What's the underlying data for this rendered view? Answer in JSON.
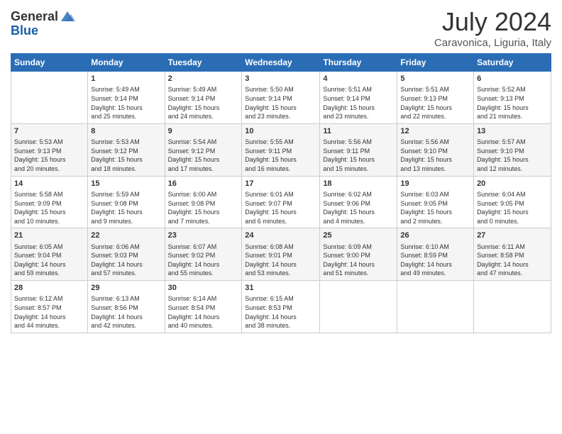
{
  "header": {
    "logo_general": "General",
    "logo_blue": "Blue",
    "month_title": "July 2024",
    "location": "Caravonica, Liguria, Italy"
  },
  "days_of_week": [
    "Sunday",
    "Monday",
    "Tuesday",
    "Wednesday",
    "Thursday",
    "Friday",
    "Saturday"
  ],
  "weeks": [
    [
      {
        "day": "",
        "content": ""
      },
      {
        "day": "1",
        "content": "Sunrise: 5:49 AM\nSunset: 9:14 PM\nDaylight: 15 hours\nand 25 minutes."
      },
      {
        "day": "2",
        "content": "Sunrise: 5:49 AM\nSunset: 9:14 PM\nDaylight: 15 hours\nand 24 minutes."
      },
      {
        "day": "3",
        "content": "Sunrise: 5:50 AM\nSunset: 9:14 PM\nDaylight: 15 hours\nand 23 minutes."
      },
      {
        "day": "4",
        "content": "Sunrise: 5:51 AM\nSunset: 9:14 PM\nDaylight: 15 hours\nand 23 minutes."
      },
      {
        "day": "5",
        "content": "Sunrise: 5:51 AM\nSunset: 9:13 PM\nDaylight: 15 hours\nand 22 minutes."
      },
      {
        "day": "6",
        "content": "Sunrise: 5:52 AM\nSunset: 9:13 PM\nDaylight: 15 hours\nand 21 minutes."
      }
    ],
    [
      {
        "day": "7",
        "content": "Sunrise: 5:53 AM\nSunset: 9:13 PM\nDaylight: 15 hours\nand 20 minutes."
      },
      {
        "day": "8",
        "content": "Sunrise: 5:53 AM\nSunset: 9:12 PM\nDaylight: 15 hours\nand 18 minutes."
      },
      {
        "day": "9",
        "content": "Sunrise: 5:54 AM\nSunset: 9:12 PM\nDaylight: 15 hours\nand 17 minutes."
      },
      {
        "day": "10",
        "content": "Sunrise: 5:55 AM\nSunset: 9:11 PM\nDaylight: 15 hours\nand 16 minutes."
      },
      {
        "day": "11",
        "content": "Sunrise: 5:56 AM\nSunset: 9:11 PM\nDaylight: 15 hours\nand 15 minutes."
      },
      {
        "day": "12",
        "content": "Sunrise: 5:56 AM\nSunset: 9:10 PM\nDaylight: 15 hours\nand 13 minutes."
      },
      {
        "day": "13",
        "content": "Sunrise: 5:57 AM\nSunset: 9:10 PM\nDaylight: 15 hours\nand 12 minutes."
      }
    ],
    [
      {
        "day": "14",
        "content": "Sunrise: 5:58 AM\nSunset: 9:09 PM\nDaylight: 15 hours\nand 10 minutes."
      },
      {
        "day": "15",
        "content": "Sunrise: 5:59 AM\nSunset: 9:08 PM\nDaylight: 15 hours\nand 9 minutes."
      },
      {
        "day": "16",
        "content": "Sunrise: 6:00 AM\nSunset: 9:08 PM\nDaylight: 15 hours\nand 7 minutes."
      },
      {
        "day": "17",
        "content": "Sunrise: 6:01 AM\nSunset: 9:07 PM\nDaylight: 15 hours\nand 6 minutes."
      },
      {
        "day": "18",
        "content": "Sunrise: 6:02 AM\nSunset: 9:06 PM\nDaylight: 15 hours\nand 4 minutes."
      },
      {
        "day": "19",
        "content": "Sunrise: 6:03 AM\nSunset: 9:05 PM\nDaylight: 15 hours\nand 2 minutes."
      },
      {
        "day": "20",
        "content": "Sunrise: 6:04 AM\nSunset: 9:05 PM\nDaylight: 15 hours\nand 0 minutes."
      }
    ],
    [
      {
        "day": "21",
        "content": "Sunrise: 6:05 AM\nSunset: 9:04 PM\nDaylight: 14 hours\nand 59 minutes."
      },
      {
        "day": "22",
        "content": "Sunrise: 6:06 AM\nSunset: 9:03 PM\nDaylight: 14 hours\nand 57 minutes."
      },
      {
        "day": "23",
        "content": "Sunrise: 6:07 AM\nSunset: 9:02 PM\nDaylight: 14 hours\nand 55 minutes."
      },
      {
        "day": "24",
        "content": "Sunrise: 6:08 AM\nSunset: 9:01 PM\nDaylight: 14 hours\nand 53 minutes."
      },
      {
        "day": "25",
        "content": "Sunrise: 6:09 AM\nSunset: 9:00 PM\nDaylight: 14 hours\nand 51 minutes."
      },
      {
        "day": "26",
        "content": "Sunrise: 6:10 AM\nSunset: 8:59 PM\nDaylight: 14 hours\nand 49 minutes."
      },
      {
        "day": "27",
        "content": "Sunrise: 6:11 AM\nSunset: 8:58 PM\nDaylight: 14 hours\nand 47 minutes."
      }
    ],
    [
      {
        "day": "28",
        "content": "Sunrise: 6:12 AM\nSunset: 8:57 PM\nDaylight: 14 hours\nand 44 minutes."
      },
      {
        "day": "29",
        "content": "Sunrise: 6:13 AM\nSunset: 8:56 PM\nDaylight: 14 hours\nand 42 minutes."
      },
      {
        "day": "30",
        "content": "Sunrise: 6:14 AM\nSunset: 8:54 PM\nDaylight: 14 hours\nand 40 minutes."
      },
      {
        "day": "31",
        "content": "Sunrise: 6:15 AM\nSunset: 8:53 PM\nDaylight: 14 hours\nand 38 minutes."
      },
      {
        "day": "",
        "content": ""
      },
      {
        "day": "",
        "content": ""
      },
      {
        "day": "",
        "content": ""
      }
    ]
  ]
}
